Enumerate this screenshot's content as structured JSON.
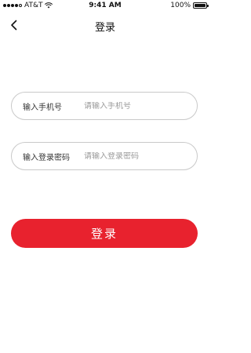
{
  "status_bar": {
    "carrier": "AT&T",
    "time": "9:41 AM",
    "battery": "100%",
    "battery_level": 1.0,
    "signal_bars_filled": 4,
    "signal_bars_total": 5
  },
  "nav": {
    "title": "登录",
    "back_icon": "chevron-left-icon"
  },
  "form": {
    "phone": {
      "label": "输入手机号",
      "placeholder": "请输入手机号",
      "value": ""
    },
    "password": {
      "label": "输入登录密码",
      "placeholder": "请输入登录密码",
      "value": ""
    }
  },
  "login_button": {
    "label": "登录"
  },
  "colors": {
    "accent": "#e8222e",
    "border": "#c9c9c9",
    "placeholder": "#9a9a9a",
    "text": "#333333"
  }
}
